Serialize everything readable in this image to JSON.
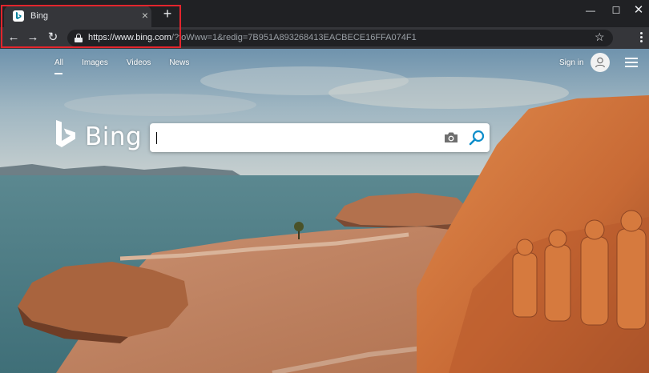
{
  "browser": {
    "tab": {
      "title": "Bing",
      "close_glyph": "×"
    },
    "new_tab_glyph": "+",
    "window_controls": {
      "minimize": "—",
      "maximize": "☐",
      "close": "✕"
    },
    "nav": {
      "back": "←",
      "forward": "→",
      "reload": "↻"
    },
    "address_bar": {
      "host": "https://www.bing.com",
      "rest": "/?toWww=1&redig=7B951A893268413EACBECE16FFA074F1"
    },
    "bookmark_glyph": "☆"
  },
  "bing": {
    "nav": [
      {
        "label": "All",
        "active": true
      },
      {
        "label": "Images",
        "active": false
      },
      {
        "label": "Videos",
        "active": false
      },
      {
        "label": "News",
        "active": false
      }
    ],
    "signin_label": "Sign in",
    "logo_text": "Bing",
    "search": {
      "value": "",
      "placeholder": ""
    }
  },
  "colors": {
    "highlight": "#e3252d",
    "chrome_dark": "#202124",
    "chrome_tab": "#35363a",
    "bing_teal": "#00809d",
    "search_icon": "#0c8dca"
  },
  "icons": {
    "lock": "lock-icon",
    "star": "star-icon",
    "camera": "camera-icon",
    "search": "search-icon",
    "avatar": "user-icon",
    "menu": "hamburger-icon"
  }
}
